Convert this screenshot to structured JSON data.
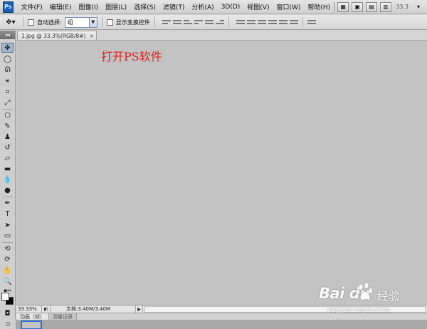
{
  "app": {
    "logo_text": "Ps"
  },
  "menu": {
    "items": [
      "文件(F)",
      "编辑(E)",
      "图像(I)",
      "图层(L)",
      "选择(S)",
      "滤镜(T)",
      "分析(A)",
      "3D(D)",
      "视图(V)",
      "窗口(W)",
      "帮助(H)"
    ],
    "zoom": "33.3"
  },
  "options": {
    "auto_select_label": "自动选择:",
    "auto_select_value": "组",
    "show_transform_label": "显示变换控件"
  },
  "document": {
    "tab_label": "1.jpg @ 33.3%(RGB/8#)",
    "canvas_text": "打开PS软件",
    "canvas_text_color": "#e02020"
  },
  "status": {
    "zoom": "33.33%",
    "doc_info": "文档:3.40M/3.40M"
  },
  "bottom_panel": {
    "tabs": [
      "动画（帧）",
      "测量记录"
    ]
  },
  "watermark": {
    "logo": "Bai  du",
    "brand": "经验",
    "url": "jingyan.baidu.com"
  },
  "colors": {
    "foreground": "#ffffff",
    "background": "#000000",
    "canvas_bg": "#c3c3c3"
  }
}
